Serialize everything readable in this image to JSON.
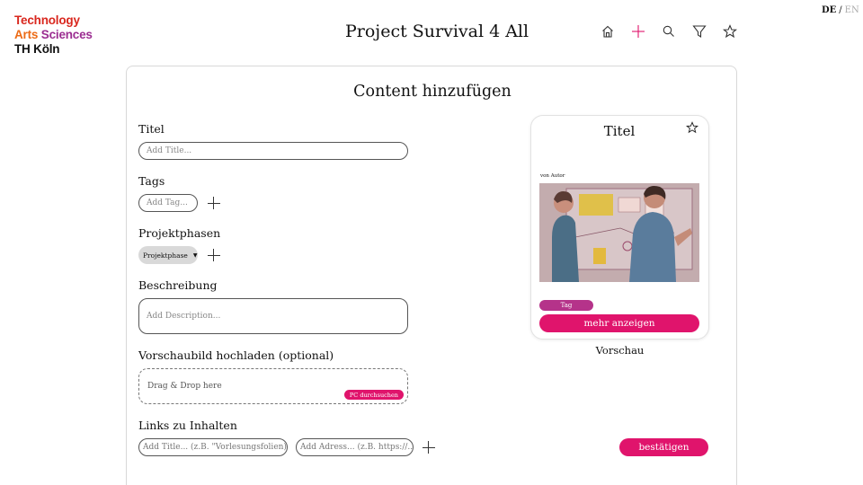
{
  "header": {
    "logo": {
      "line1": "Technology",
      "line2_a": "Arts",
      "line2_b": "Sciences",
      "line3": "TH Köln"
    },
    "title": "Project Survival 4 All",
    "nav_icons": [
      "home-icon",
      "plus-icon",
      "search-icon",
      "filter-icon",
      "star-icon"
    ],
    "lang": {
      "de": "DE",
      "separator": "/",
      "en": "EN"
    }
  },
  "form": {
    "heading": "Content hinzufügen",
    "title_label": "Titel",
    "title_placeholder": "Add Title...",
    "tags_label": "Tags",
    "tags_placeholder": "Add Tag...",
    "phases_label": "Projektphasen",
    "phase_select": "Projektphase",
    "description_label": "Beschreibung",
    "description_placeholder": "Add Description...",
    "upload_label": "Vorschaubild hochladen (optional)",
    "upload_text": "Drag & Drop here",
    "upload_button": "PC durchsuchen",
    "links_label": "Links zu Inhalten",
    "link_title_placeholder": "Add Title... (z.B. \"Vorlesungsfolien)",
    "link_address_placeholder": "Add Adress... (z.B. https://...)",
    "confirm_button": "bestätigen"
  },
  "preview": {
    "title": "Titel",
    "author": "von Autor",
    "tag": "Tag",
    "more_button": "mehr anzeigen",
    "caption": "Vorschau"
  },
  "colors": {
    "accent": "#e0146c",
    "tag": "#b5338a",
    "logo_red": "#d9271e",
    "logo_orange": "#ec6a14",
    "logo_purple": "#9b2d91"
  }
}
